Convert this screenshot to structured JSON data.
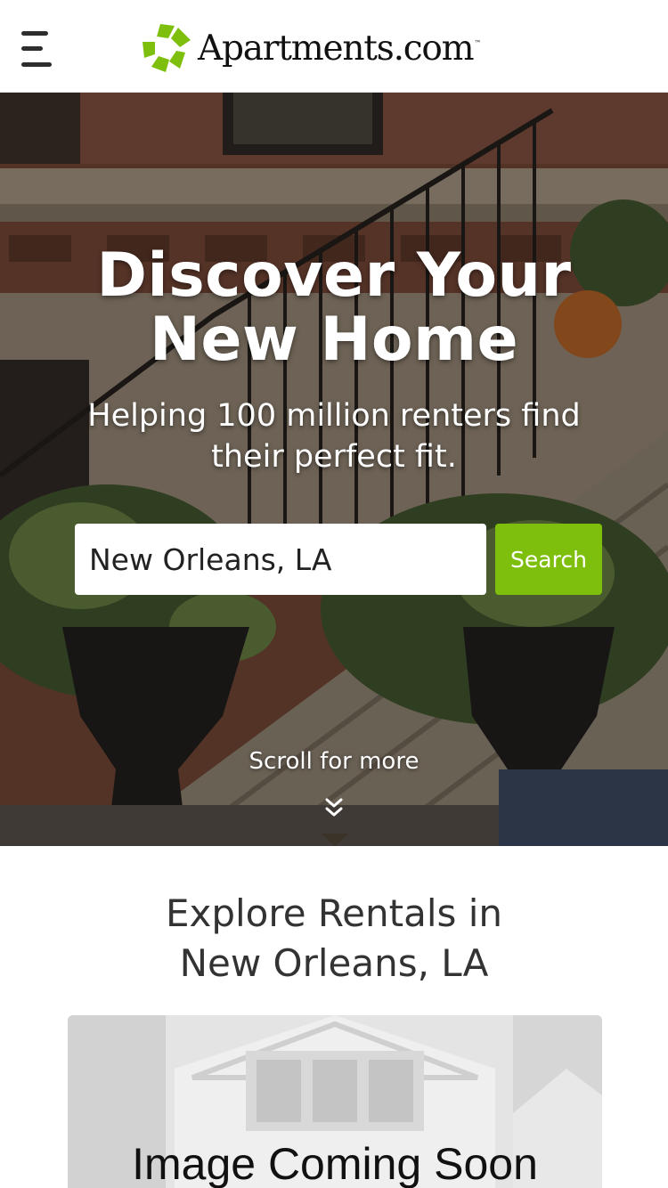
{
  "header": {
    "logo_text": "Apartments.com",
    "logo_tm": "™",
    "menu_icon": "hamburger-menu-icon",
    "brand_color": "#7ebf0e"
  },
  "hero": {
    "title_line1": "Discover Your",
    "title_line2": "New Home",
    "subtitle_line1": "Helping 100 million renters find",
    "subtitle_line2": "their perfect fit.",
    "search": {
      "value": "New Orleans, LA",
      "button_label": "Search",
      "button_color": "#7ebf0e"
    },
    "scroll_label": "Scroll for more",
    "scroll_icon": "double-chevron-down-icon"
  },
  "explore": {
    "title_line1": "Explore Rentals in",
    "title_line2": "New Orleans, LA",
    "card": {
      "image_label": "Image Coming Soon"
    }
  }
}
